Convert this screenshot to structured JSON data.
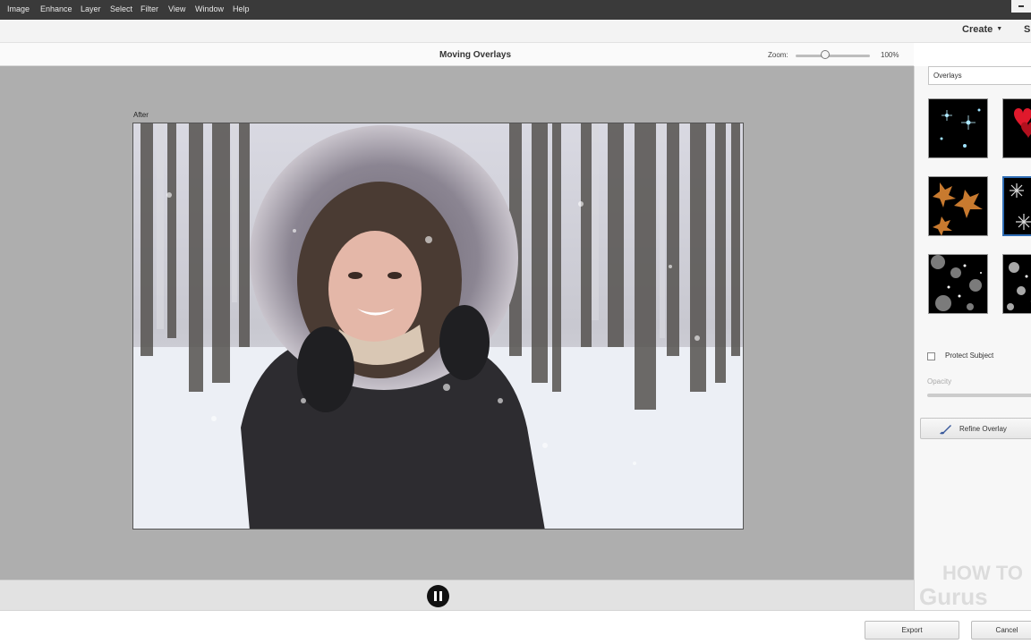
{
  "menu": {
    "items": [
      "Image",
      "Enhance",
      "Layer",
      "Select",
      "Filter",
      "View",
      "Window",
      "Help"
    ]
  },
  "appbar": {
    "create_label": "Create",
    "s_label": "S"
  },
  "document": {
    "title": "Moving Overlays",
    "zoom_label": "Zoom:",
    "zoom_value": "100%",
    "zoom_percent": 100,
    "view_label": "After"
  },
  "panel": {
    "category": "Overlays",
    "thumbnails": [
      {
        "name": "sparkles",
        "selected": false
      },
      {
        "name": "hearts",
        "selected": false
      },
      {
        "name": "autumn-leaves",
        "selected": false
      },
      {
        "name": "snowflakes",
        "selected": true
      },
      {
        "name": "bokeh-light",
        "selected": false
      },
      {
        "name": "bokeh-dark",
        "selected": false
      }
    ],
    "protect_subject_label": "Protect Subject",
    "protect_subject_checked": false,
    "opacity_label": "Opacity",
    "refine_label": "Refine Overlay"
  },
  "footer": {
    "export_label": "Export",
    "cancel_label": "Cancel"
  },
  "watermark": {
    "text": "HOW TO Gurus"
  },
  "colors": {
    "menubar": "#3a3a3a",
    "canvas_bg": "#aeaeae",
    "selection": "#2f6db5"
  },
  "icons": [
    "pause-icon",
    "brush-icon",
    "minimize-icon",
    "chevron-down-icon"
  ]
}
